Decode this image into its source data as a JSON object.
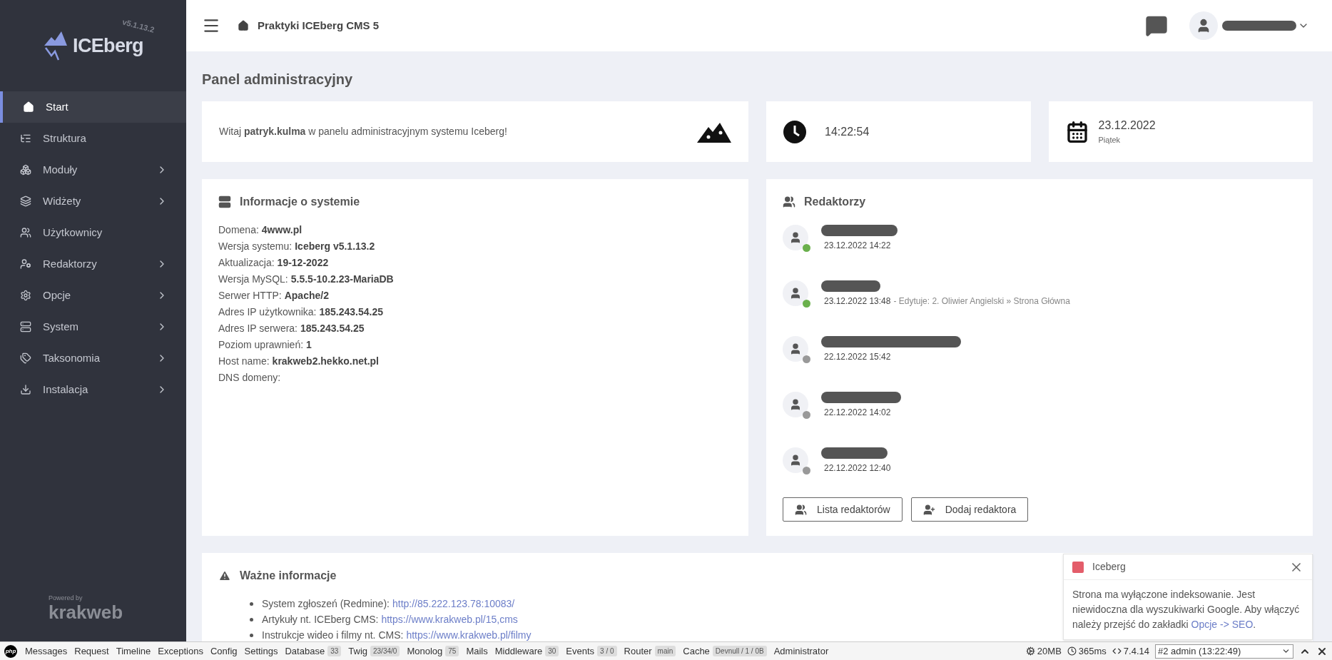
{
  "sidebar": {
    "logo_text": "ICEberg",
    "version": "v5.1.13.2",
    "powered_by": "Powered by",
    "powered_brand": "krakweb",
    "items": [
      {
        "label": "Start",
        "selected": true,
        "has_submenu": false
      },
      {
        "label": "Struktura",
        "selected": false,
        "has_submenu": false
      },
      {
        "label": "Moduły",
        "selected": false,
        "has_submenu": true
      },
      {
        "label": "Widżety",
        "selected": false,
        "has_submenu": true
      },
      {
        "label": "Użytkownicy",
        "selected": false,
        "has_submenu": false
      },
      {
        "label": "Redaktorzy",
        "selected": false,
        "has_submenu": true
      },
      {
        "label": "Opcje",
        "selected": false,
        "has_submenu": true
      },
      {
        "label": "System",
        "selected": false,
        "has_submenu": true
      },
      {
        "label": "Taksonomia",
        "selected": false,
        "has_submenu": true
      },
      {
        "label": "Instalacja",
        "selected": false,
        "has_submenu": true
      }
    ]
  },
  "header": {
    "breadcrumb": "Praktyki ICEberg CMS 5"
  },
  "page_title": "Panel administracyjny",
  "welcome": {
    "text": "Witaj **patryk.kulma** w panelu administracyjnym systemu Iceberg!"
  },
  "clock": {
    "time": "14:22:54"
  },
  "date": {
    "date": "23.12.2022",
    "weekday": "Piątek"
  },
  "system_info": {
    "title": "Informacje o systemie",
    "rows": [
      {
        "label": "Domena:",
        "value": "4www.pl"
      },
      {
        "label": "Wersja systemu:",
        "value": "Iceberg v5.1.13.2"
      },
      {
        "label": "Aktualizacja:",
        "value": "19-12-2022"
      },
      {
        "label": "Wersja MySQL:",
        "value": "5.5.5-10.2.23-MariaDB"
      },
      {
        "label": "Serwer HTTP:",
        "value": "Apache/2"
      },
      {
        "label": "Adres IP użytkownika:",
        "value": "185.243.54.25"
      },
      {
        "label": "Adres IP serwera:",
        "value": "185.243.54.25"
      },
      {
        "label": "Poziom uprawnień:",
        "value": "1"
      },
      {
        "label": "Host name:",
        "value": "krakweb2.hekko.net.pl"
      },
      {
        "label": "DNS domeny:"
      }
    ]
  },
  "editors": {
    "title": "Redaktorzy",
    "items": [
      {
        "date": "23.12.2022 14:22",
        "online": true
      },
      {
        "date": "23.12.2022 13:48",
        "online": true,
        "activity": "- Edytuje: 2. Oliwier Angielski » Strona Główna"
      },
      {
        "date": "22.12.2022 15:42",
        "online": false
      },
      {
        "date": "22.12.2022 14:02",
        "online": false
      },
      {
        "date": "22.12.2022 12:40",
        "online": false
      }
    ],
    "buttons": [
      {
        "label": "Lista redaktorów"
      },
      {
        "label": "Dodaj redaktora"
      }
    ]
  },
  "important": {
    "title": "Ważne informacje",
    "items": [
      {
        "label": "System zgłoszeń (Redmine):",
        "link": "http://85.222.123.78:10083/"
      },
      {
        "label": "Artykuły nt. ICEberg CMS:",
        "link": "https://www.krakweb.pl/15,cms"
      },
      {
        "label": "Instrukcje wideo i filmy nt. CMS:",
        "link": "https://www.krakweb.pl/filmy"
      }
    ]
  },
  "toast": {
    "title": "Iceberg",
    "color": "#e35d6a",
    "text": "Strona ma wyłączone indeksowanie. Jest niewidoczna dla wyszukiwarki Google. Aby włączyć należy przejść do zakładki",
    "link": "Opcje -> SEO",
    "end": "."
  },
  "debug_bar": {
    "logo": "php",
    "items": [
      {
        "label": "Messages"
      },
      {
        "label": "Request"
      },
      {
        "label": "Timeline"
      },
      {
        "label": "Exceptions"
      },
      {
        "label": "Config"
      },
      {
        "label": "Settings"
      },
      {
        "label": "Database",
        "badge": "33"
      },
      {
        "label": "Twig",
        "badge": "23/34/0"
      },
      {
        "label": "Monolog",
        "badge": "75"
      },
      {
        "label": "Mails"
      },
      {
        "label": "Middleware",
        "badge": "30"
      },
      {
        "label": "Events",
        "badge": "3 / 0"
      },
      {
        "label": "Router",
        "badge": "main"
      },
      {
        "label": "Cache",
        "badge": "Devnull / 1 / 0B"
      },
      {
        "label": "Administrator"
      }
    ],
    "memory": "20MB",
    "time": "365ms",
    "php_version": "7.4.14",
    "request": "#2 admin (13:22:49)"
  }
}
